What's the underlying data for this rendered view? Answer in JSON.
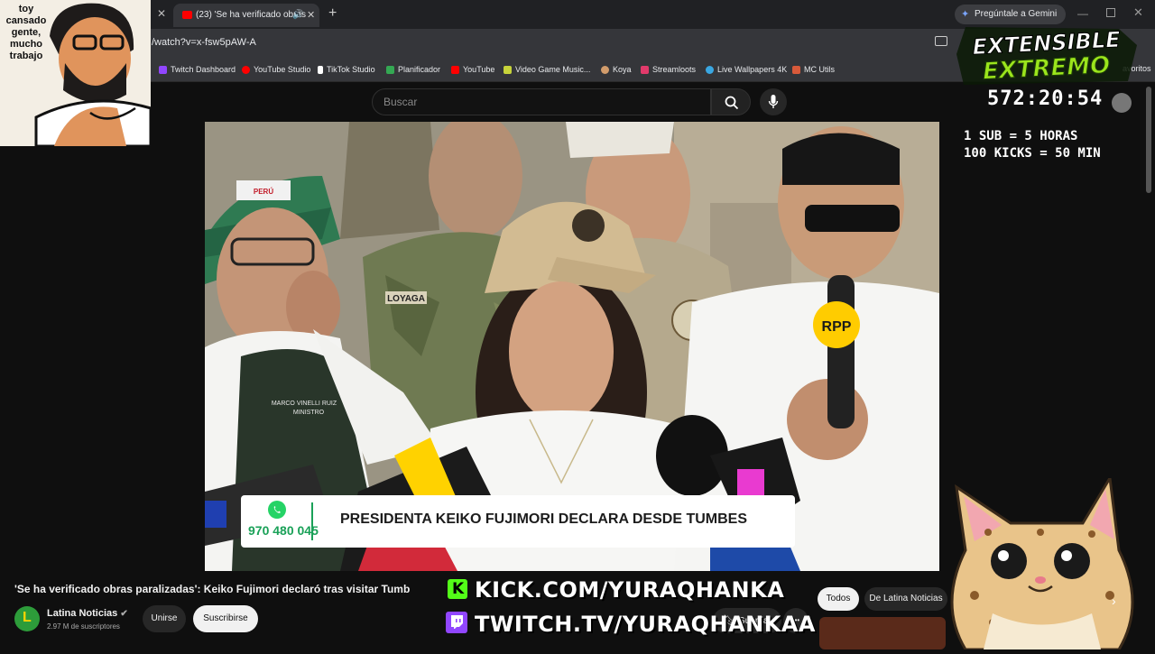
{
  "browser": {
    "tab_title": "(23) 'Se ha verificado obras",
    "new_tab": "+",
    "url": "/watch?v=x-fsw5pAW-A",
    "gemini_label": "Pregúntale a Gemini",
    "favorites_label": "avoritos",
    "bookmarks": [
      {
        "label": "Twitch Dashboard",
        "color": "#9146ff"
      },
      {
        "label": "YouTube Studio",
        "color": "#ff0000"
      },
      {
        "label": "TikTok Studio",
        "color": "#111111"
      },
      {
        "label": "Planificador",
        "color": "#34a853"
      },
      {
        "label": "YouTube",
        "color": "#ff0000"
      },
      {
        "label": "Video Game Music...",
        "color": "#c7d33a"
      },
      {
        "label": "Koya",
        "color": "#d29c6b"
      },
      {
        "label": "Streamloots",
        "color": "#e23a6b"
      },
      {
        "label": "Live Wallpapers 4K",
        "color": "#3aa7e2"
      },
      {
        "label": "MC Utils",
        "color": "#d85a3a"
      }
    ]
  },
  "youtube": {
    "search_placeholder": "Buscar",
    "video_title": "'Se ha verificado obras paralizadas': Keiko Fujimori declaró tras visitar Tumb",
    "channel_name": "Latina Noticias",
    "subscribers": "2.97 M de suscriptores",
    "join_label": "Unirse",
    "subscribe_label": "Suscribirse",
    "save_label": "Guardar",
    "more_label": "•••",
    "chips": [
      "Todos",
      "De Latina Noticias"
    ]
  },
  "video": {
    "whatsapp_number": "970 480 045",
    "headline": "PRESIDENTA KEIKO FUJIMORI DECLARA DESDE TUMBES",
    "mic_logo": "RPP",
    "vest_name": "MARCO VINELLI RUIZ",
    "vest_role": "MINISTRO",
    "badge_name": "LOYAGA",
    "cap_patch": "PERÚ"
  },
  "stream_overlay": {
    "avatar_caption": [
      "toy",
      "cansado",
      "gente,",
      "mucho",
      "trabajo"
    ],
    "logo_line1": "EXTENSIBLE",
    "logo_line2": "EXTREMO",
    "timer": "572:20:54",
    "rule1": "1 SUB = 5 HORAS",
    "rule2": "100 KICKS = 50 MIN",
    "kick_url": "KICK.COM/YURAQHANKA",
    "twitch_url": "TWITCH.TV/YURAQHANKAA",
    "colors": {
      "neon_green": "#9be51c",
      "kick_green": "#53fc18",
      "twitch_purple": "#9146ff"
    }
  }
}
